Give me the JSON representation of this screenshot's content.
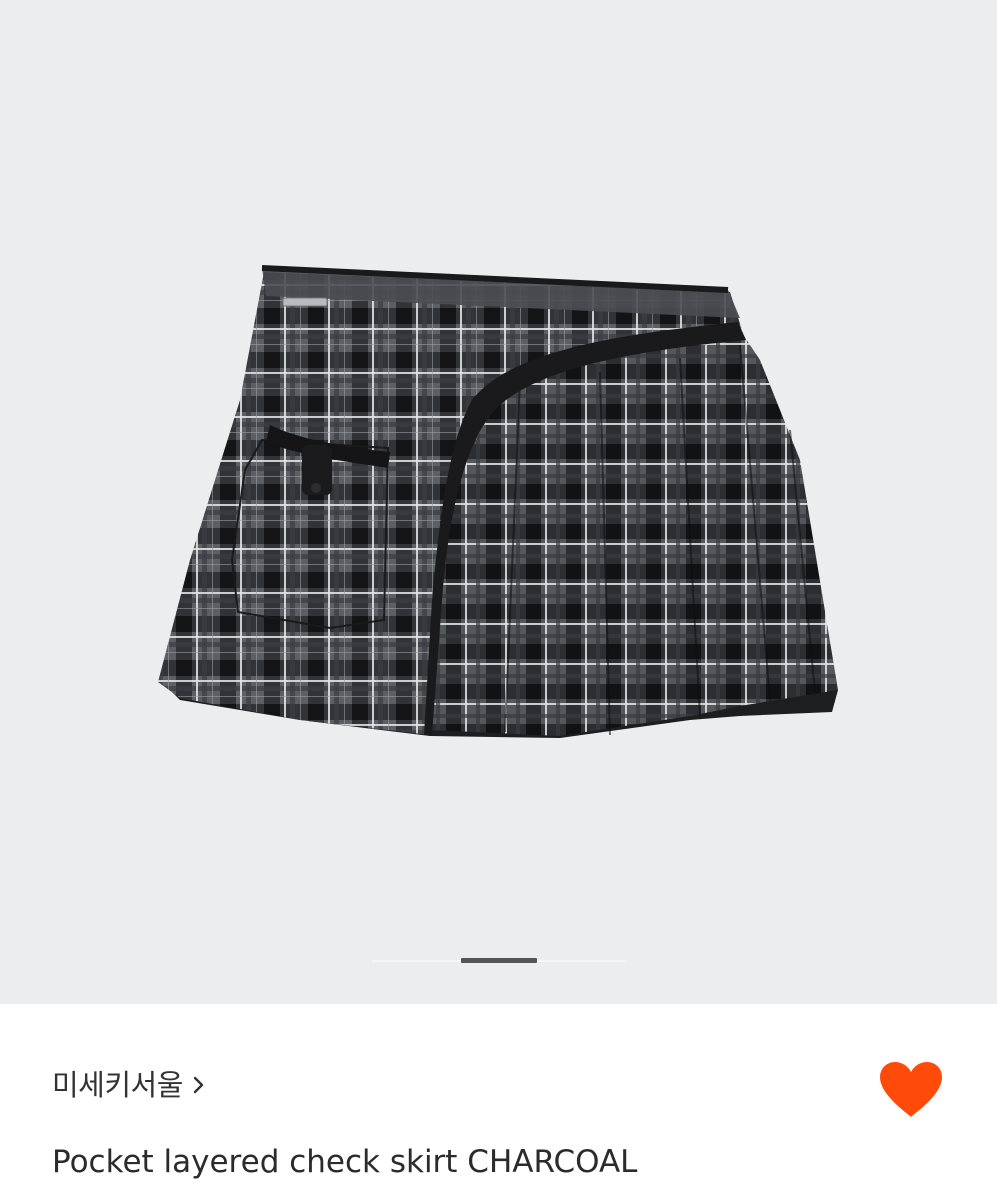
{
  "product": {
    "brand": "미세키서울",
    "title": "Pocket layered check skirt CHARCOAL",
    "liked": true,
    "image_subject": "skirt-photo"
  },
  "gallery": {
    "current_index": 1,
    "progress_fraction": 0.3
  },
  "icons": {
    "brand_chevron": "chevron-right-icon",
    "like": "heart-icon"
  },
  "colors": {
    "gallery_background": "#ecedef",
    "heart": "#ff4b0a",
    "title_text": "#2b2b2b",
    "brand_text": "#333333"
  }
}
